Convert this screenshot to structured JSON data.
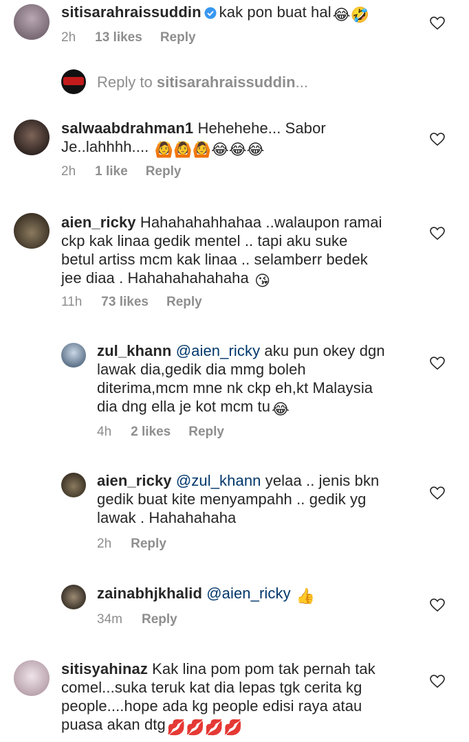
{
  "comments": [
    {
      "username": "sitisarahraissuddin",
      "verified": true,
      "text": "kak pon buat hal",
      "emoji": "😂🤣",
      "time": "2h",
      "likes": "13 likes",
      "reply": "Reply",
      "avatar_color": "#8a7f88"
    },
    {
      "username": "salwaabdrahman1",
      "text": "Hehehehe... Sabor",
      "text2": "Je..lahhhh....",
      "emoji": "🙆🙆🙆😂😂😂",
      "time": "2h",
      "likes": "1 like",
      "reply": "Reply",
      "avatar_color": "#4a3a34"
    },
    {
      "username": "aien_ricky",
      "text": "Hahahahahhahaa ..walaupon ramai",
      "line2": "ckp kak linaa gedik mentel .. tapi aku suke",
      "line3": "betul artiss mcm kak linaa .. selamberr bedek",
      "line4": "jee diaa . Hahahahahahaha",
      "emoji": "😘",
      "time": "11h",
      "likes": "73 likes",
      "reply": "Reply",
      "avatar_color": "#6b5a45"
    },
    {
      "username": "zainabhjkhalid",
      "mention": "@aien_ricky",
      "emoji": "👍",
      "time": "34m",
      "reply": "Reply",
      "avatar_color": "#6a5f4f"
    },
    {
      "username": "sitisyahinaz",
      "text": "Kak lina pom pom tak pernah tak",
      "line2": "comel...suka teruk kat dia lepas tgk cerita kg",
      "line3": "people....hope ada kg people edisi raya atau",
      "line4": "puasa akan dtg",
      "emoji": "💋💋💋💋",
      "avatar_color": "#c8b7bd"
    }
  ],
  "replies": [
    {
      "username": "zul_khann",
      "mention": "@aien_ricky",
      "text": "aku pun okey dgn",
      "line2": "lawak dia,gedik dia mmg boleh",
      "line3": "diterima,mcm mne nk ckp eh,kt Malaysia",
      "line4": "dia dng ella je kot mcm tu",
      "emoji": "😂",
      "time": "4h",
      "likes": "2 likes",
      "reply": "Reply",
      "avatar_color": "#7d8fa3"
    },
    {
      "username": "aien_ricky",
      "mention": "@zul_khann",
      "text": "yelaa .. jenis bkn",
      "line2": "gedik buat kite menyampahh .. gedik yg",
      "line3": "lawak . Hahahahaha",
      "time": "2h",
      "reply": "Reply",
      "avatar_color": "#6b5a45"
    }
  ],
  "reply_to": {
    "prefix": "Reply to",
    "username": "sitisarahraissuddin",
    "suffix": "..."
  },
  "icons": {
    "heart": "heart-icon",
    "verified": "verified-badge-icon"
  }
}
